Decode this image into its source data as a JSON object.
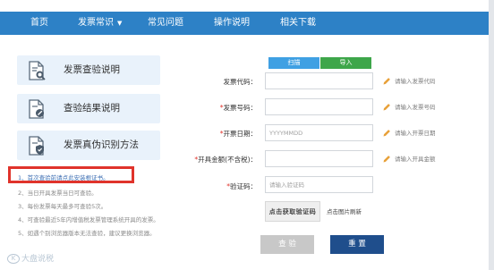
{
  "nav": {
    "items": [
      {
        "label": "首页"
      },
      {
        "label": "发票常识"
      },
      {
        "label": "常见问题"
      },
      {
        "label": "操作说明"
      },
      {
        "label": "相关下载"
      }
    ]
  },
  "sidebar": {
    "cards": [
      {
        "label": "发票查验说明",
        "icon": "document-search-icon"
      },
      {
        "label": "查验结果说明",
        "icon": "document-edit-icon"
      },
      {
        "label": "发票真伪识别方法",
        "icon": "document-shield-icon"
      }
    ],
    "tips": [
      "1、首次查验前请点此安装根证书。",
      "2、当日开具发票当日可查验。",
      "3、每份发票每天最多可查验5次。",
      "4、可查验最近5年内增值税发票管理系统开具的发票。",
      "5、如遇个别浏览器版本无法查验，建议更换浏览器。"
    ]
  },
  "toolbar": {
    "scan_label": "扫描",
    "import_label": "导入"
  },
  "form": {
    "invoice_code": {
      "label": "发票代码：",
      "required": false,
      "placeholder": "",
      "hint": "请输入发票代码"
    },
    "invoice_number": {
      "label": "发票号码：",
      "required": true,
      "placeholder": "",
      "hint": "请输入发票号码"
    },
    "issue_date": {
      "label": "开票日期：",
      "required": true,
      "placeholder": "YYYYMMDD",
      "hint": "请输入开票日期"
    },
    "amount": {
      "label": "开具金额(不含税)：",
      "required": true,
      "placeholder": "",
      "hint": "请输入开具金额"
    },
    "captcha": {
      "label": "验证码：",
      "required": true,
      "placeholder": "请输入验证码"
    },
    "captcha_image_text": "点击获取验证码",
    "captcha_refresh": "点击图片刷新"
  },
  "actions": {
    "check_label": "查 验",
    "reset_label": "重 置"
  },
  "watermark": {
    "text": "大盘说税"
  },
  "colors": {
    "nav_bg": "#2d81c6",
    "card_bg": "#e9f2fb",
    "required": "#e0332b",
    "scan_btn": "#3fa0e3",
    "import_btn": "#3ea64a",
    "reset_btn": "#1f4e8c",
    "check_btn": "#c8c8c8",
    "highlight_border": "#e0332b"
  }
}
